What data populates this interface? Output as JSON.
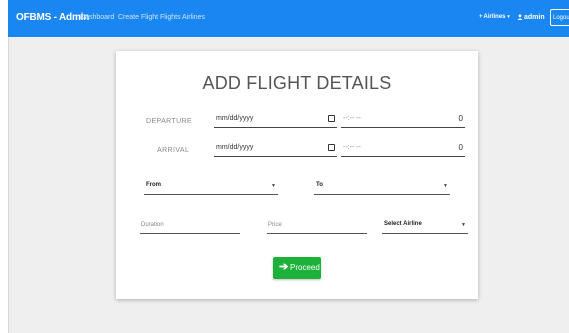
{
  "navbar": {
    "brand": "OFBMS - Admin",
    "links": [
      "Dashboard",
      "Create Flight",
      "Flights",
      "Airlines"
    ],
    "airlines_menu": "Airlines",
    "user": "admin",
    "logout": "Logout"
  },
  "form": {
    "title": "ADD FLIGHT DETAILS",
    "departure": {
      "label": "DEPARTURE",
      "date_placeholder": "mm/dd/yyyy",
      "time_placeholder": "--:-- --",
      "value": "0"
    },
    "arrival": {
      "label": "ARRIVAL",
      "date_placeholder": "mm/dd/yyyy",
      "time_placeholder": "--:-- --",
      "value": "0"
    },
    "from": "From",
    "to": "To",
    "duration_placeholder": "Duration",
    "price_placeholder": "Price",
    "airline_select": "Select Airline",
    "proceed": "Proceed"
  },
  "colors": {
    "navbar": "#1a86f2",
    "proceed": "#1db13a",
    "page_bg": "#efefef"
  }
}
